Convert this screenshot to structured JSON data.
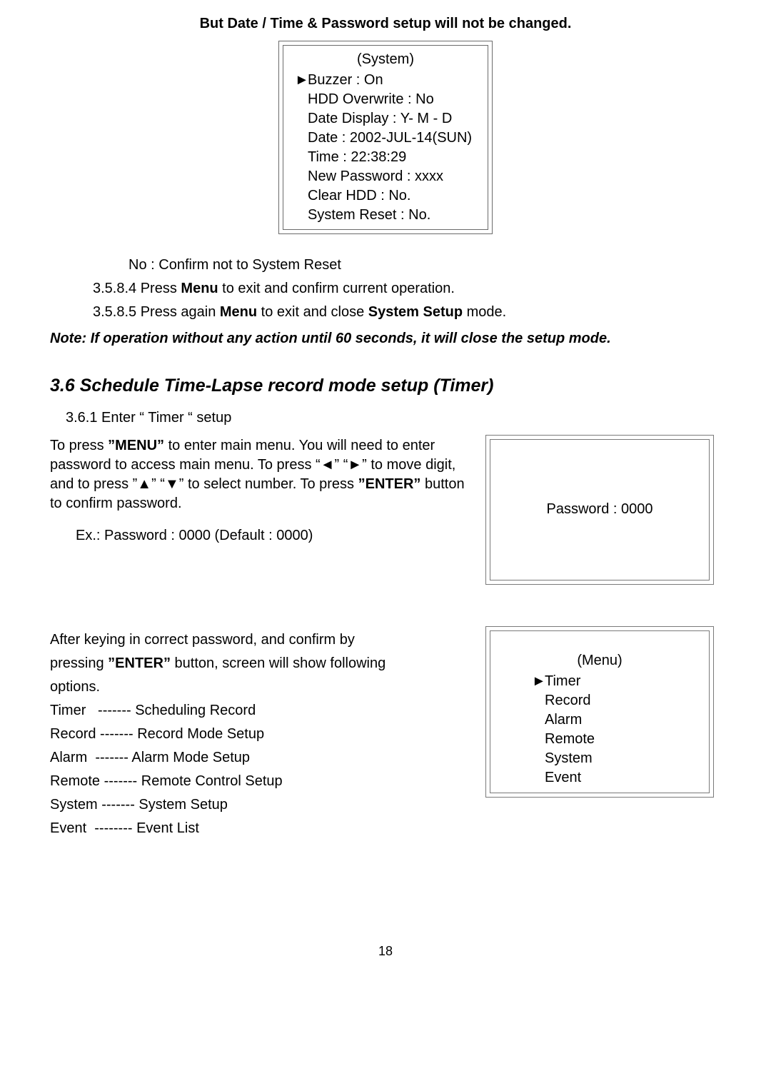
{
  "header": "But Date / Time & Password setup will not be changed.",
  "systemBox": {
    "title": "(System)",
    "pointer": "►",
    "rows": [
      "Buzzer : On",
      "HDD Overwrite : No",
      "Date Display : Y- M - D",
      "Date : 2002-JUL-14(SUN)",
      "Time : 22:38:29",
      "New Password : xxxx",
      "Clear HDD : No.",
      "System Reset : No."
    ]
  },
  "noLine": {
    "label": "No",
    "rest": " : Confirm not to System Reset"
  },
  "step4": {
    "prefix": "3.5.8.4 Press ",
    "bold": "Menu",
    "suffix": " to exit and confirm current operation."
  },
  "step5": {
    "prefix": "3.5.8.5 Press again ",
    "bold1": "Menu",
    "mid": " to exit and close ",
    "bold2": "System Setup",
    "suffix": " mode."
  },
  "note": "Note: If operation without any action until 60 seconds, it will close the setup mode.",
  "section36": {
    "heading": "3.6    Schedule Time-Lapse record mode setup (Timer)",
    "enterLabel": "3.6.1 Enter “ Timer “ setup",
    "para1a": "To press ",
    "para1b": "”MENU”",
    "para1c": " to enter main menu. You will need to enter password to access main menu. To press “◄” “►”   to move digit, and to press   ”▲” “▼” to select number. To press ",
    "para1d": "”ENTER”",
    "para1e": " button to confirm password.",
    "exLine": "Ex.: Password : 0000   (Default : 0000)"
  },
  "passwordBox": "Password : 0000",
  "afterBlock": {
    "line1": "After keying in correct password, and confirm by",
    "line2a": "pressing ",
    "line2b": "”ENTER”",
    "line2c": " button, screen will show following",
    "line3": "options.",
    "listLines": [
      "Timer   ------- Scheduling Record",
      "Record ------- Record Mode Setup",
      "Alarm  ------- Alarm Mode Setup",
      "Remote ------- Remote Control Setup",
      "System ------- System Setup",
      "Event  -------- Event List"
    ]
  },
  "menuBox": {
    "title": "(Menu)",
    "pointer": "►",
    "rows": [
      "Timer",
      "Record",
      "Alarm",
      "Remote",
      "System",
      "Event"
    ]
  },
  "pageNumber": "18"
}
